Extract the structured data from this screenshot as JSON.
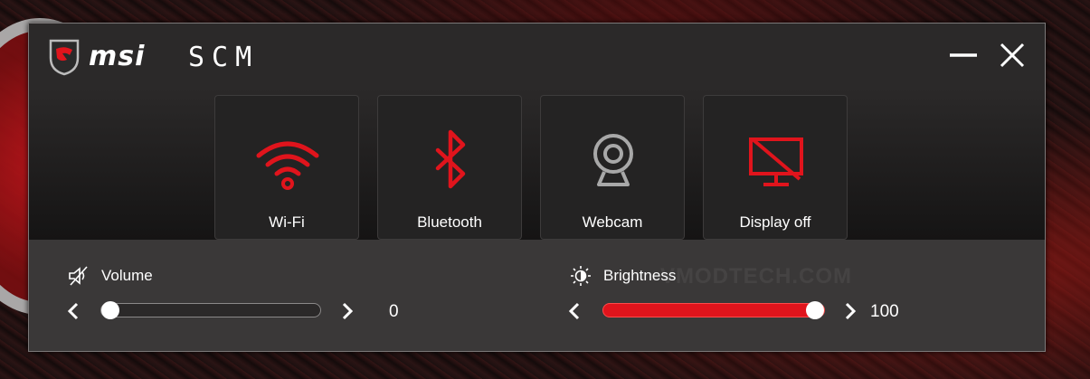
{
  "app": {
    "brand": "msi",
    "name": "SCM"
  },
  "window_controls": {
    "minimize": "minimize",
    "close": "close"
  },
  "tiles": [
    {
      "label": "Wi-Fi",
      "icon": "wifi-icon",
      "active": true
    },
    {
      "label": "Bluetooth",
      "icon": "bluetooth-icon",
      "active": true
    },
    {
      "label": "Webcam",
      "icon": "webcam-icon",
      "active": false
    },
    {
      "label": "Display off",
      "icon": "display-off-icon",
      "active": true
    }
  ],
  "volume": {
    "label": "Volume",
    "icon": "speaker-muted-icon",
    "value": "0",
    "level": 0
  },
  "brightness": {
    "label": "Brightness",
    "icon": "brightness-icon",
    "value": "100",
    "level": 100
  },
  "watermark": "VMODTECH.COM",
  "colors": {
    "accent": "#e0141c",
    "window_bg": "#2b2929",
    "panel_bg": "#3a3838",
    "text": "#ffffff",
    "icon_inactive": "#a8a8a8"
  }
}
